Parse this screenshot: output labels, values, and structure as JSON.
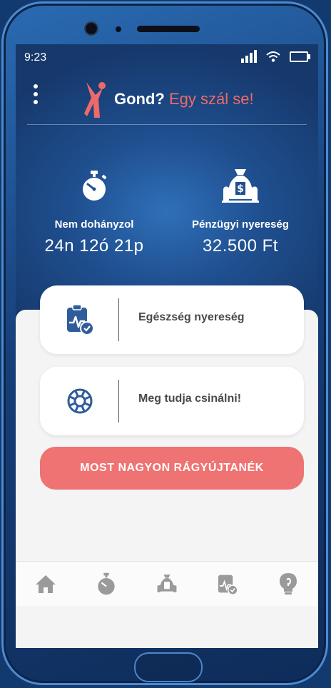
{
  "status": {
    "time": "9:23"
  },
  "app": {
    "logo_question": "Gond?",
    "logo_rest": "Egy szál se!"
  },
  "stats": {
    "smoke_free": {
      "label": "Nem dohányzol",
      "value": "24n 12ó 21p",
      "icon": "stopwatch-icon"
    },
    "savings": {
      "label": "Pénzügyi nyereség",
      "value": "32.500 Ft",
      "icon": "money-bag-icon"
    }
  },
  "cards": [
    {
      "label": "Egészség nyereség",
      "icon": "health-clipboard-icon"
    },
    {
      "label": "Meg tudja csinálni!",
      "icon": "lifebuoy-icon"
    }
  ],
  "cta": {
    "label": "MOST NAGYON RÁGYÚJTANÉK"
  },
  "nav": [
    "home-icon",
    "stopwatch-icon",
    "money-bag-icon",
    "health-clipboard-icon",
    "lightbulb-icon"
  ],
  "colors": {
    "brand_blue": "#1f4f8f",
    "accent_red": "#ee7372",
    "icon_blue": "#2f5d9c"
  }
}
